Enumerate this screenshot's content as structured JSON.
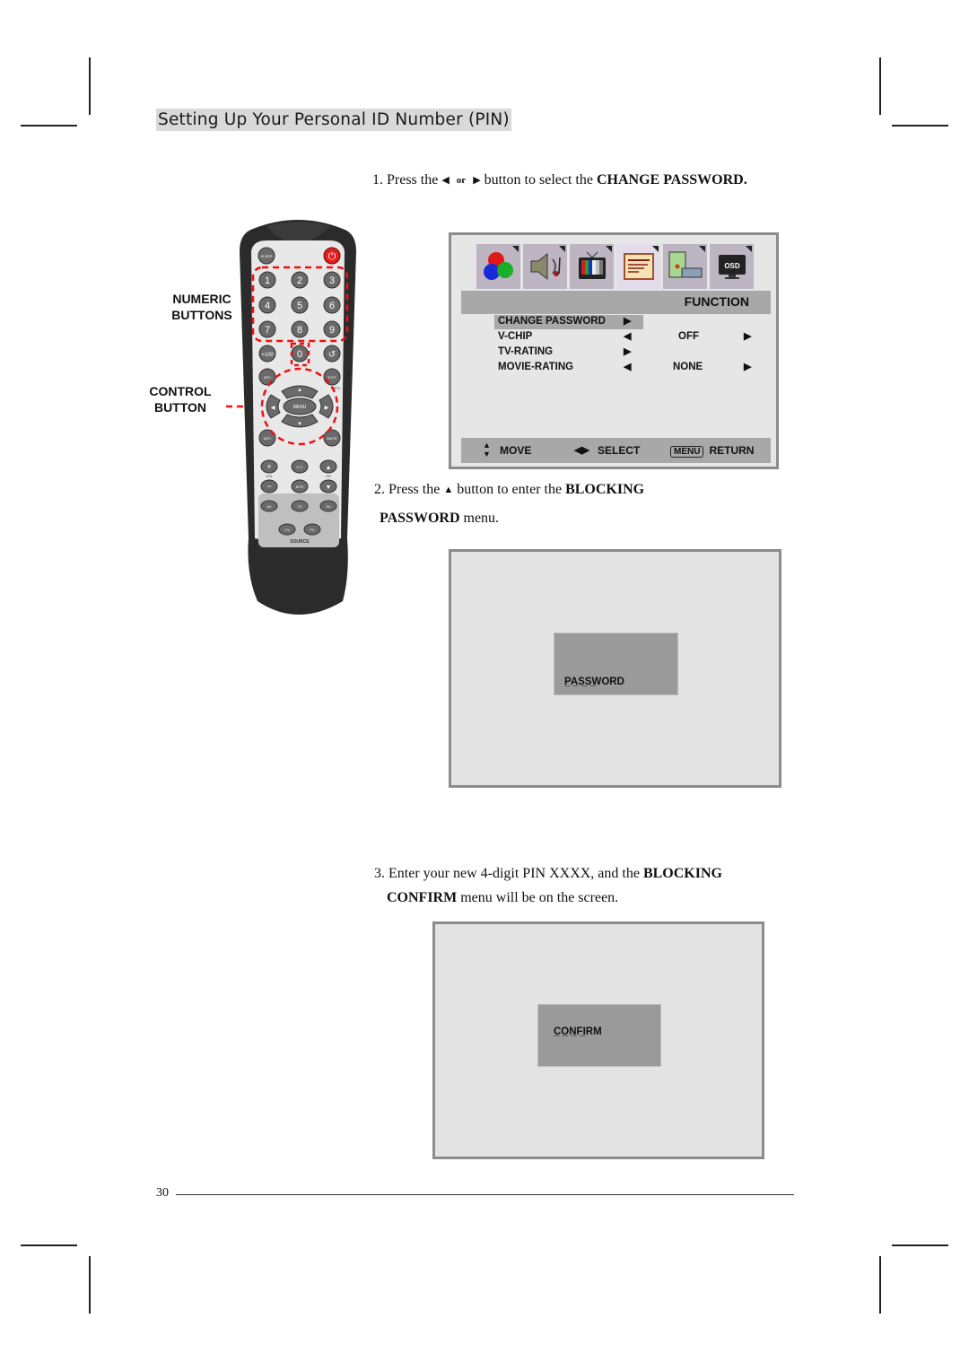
{
  "page": {
    "title": "Setting Up Your Personal ID Number (PIN)",
    "page_number": "30"
  },
  "step1": {
    "prefix": "1. Press the",
    "left_arrow": "◀",
    "or": "or",
    "right_arrow": "▶",
    "middle": "button to select the",
    "bold": "CHANGE PASSWORD."
  },
  "step2": {
    "prefix": "2. Press the",
    "up_arrow": "▲",
    "middle": "button to enter the",
    "bold1": "BLOCKING",
    "bold2": "PASSWORD",
    "suffix": "menu."
  },
  "step3": {
    "line1_prefix": "3. Enter your new 4-digit PIN XXXX, and the",
    "bold1": "BLOCKING",
    "bold2": "CONFIRM",
    "line2_suffix": "menu will be on the screen."
  },
  "remote": {
    "callout_numeric_line1": "NUMERIC",
    "callout_numeric_line2": "BUTTONS",
    "callout_control_line1": "CONTROL",
    "callout_control_line2": "BUTTON",
    "buttons": {
      "sleep": "SLEEP",
      "digits": [
        "1",
        "2",
        "3",
        "4",
        "5",
        "6",
        "7",
        "8",
        "9"
      ],
      "plus100": "+100",
      "zero": "0",
      "apc": "APC",
      "exit": "EXIT",
      "info": "INFO",
      "menu": "MENU",
      "arc": "ARC",
      "mute": "MUTE",
      "vol": "VOL",
      "ch": "CH",
      "cc": "C.C",
      "mts": "MTS",
      "av": "AV",
      "tv": "TV",
      "sv": "SV",
      "cv": "CV",
      "pc": "PC",
      "source": "SOURCE"
    }
  },
  "tv_menu": {
    "icons": [
      "picture-icon",
      "sound-icon",
      "tv-icon",
      "function-icon",
      "pc-icon",
      "osd-icon"
    ],
    "active_icon_index": 3,
    "osd_label": "OSD",
    "section_title": "FUNCTION",
    "rows": [
      {
        "label": "CHANGE PASSWORD",
        "left_arrow": "",
        "value": "",
        "right_arrow": "▶",
        "selected": true
      },
      {
        "label": "V-CHIP",
        "left_arrow": "◀",
        "value": "OFF",
        "right_arrow": "▶",
        "selected": false
      },
      {
        "label": "TV-RATING",
        "left_arrow": "",
        "value": "",
        "right_arrow": "▶",
        "selected": false
      },
      {
        "label": "MOVIE-RATING",
        "left_arrow": "◀",
        "value": "NONE",
        "right_arrow": "▶",
        "selected": false
      }
    ],
    "footer": {
      "move_label": "MOVE",
      "select_label": "SELECT",
      "menu_key": "MENU",
      "return_label": "RETURN"
    }
  },
  "password_screen": {
    "label": "PASSWORD",
    "placeholder": "_ _ _ _"
  },
  "confirm_screen": {
    "label": "CONFIRM",
    "placeholder": "_ _ _ _"
  }
}
